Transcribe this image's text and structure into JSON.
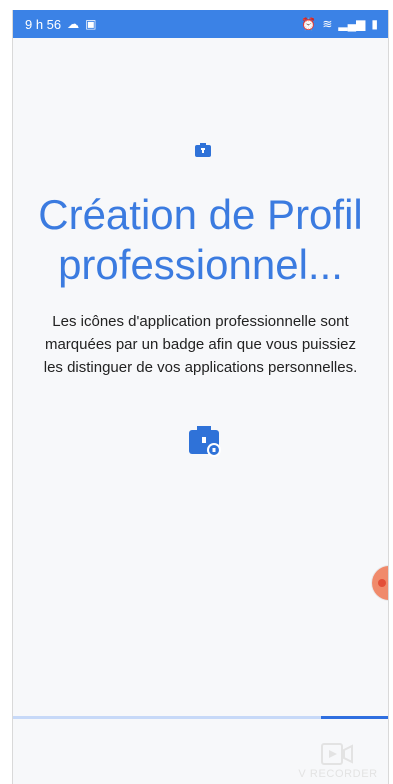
{
  "status_bar": {
    "time": "9 h 56",
    "left_icons": [
      "cloud-icon",
      "video-icon"
    ],
    "right_icons": [
      "alarm-icon",
      "wifi-icon",
      "signal-icon",
      "battery-icon"
    ]
  },
  "setup": {
    "title": "Création de Profil professionnel...",
    "description": "Les icônes d'application professionnelle sont marquées par un badge afin que vous puissiez les distinguer de vos applications personnelles."
  },
  "progress": {
    "value": 0.18
  },
  "watermark": {
    "text": "V RECORDER"
  },
  "colors": {
    "accent": "#3b7be0",
    "status_bar": "#3b82e6"
  }
}
